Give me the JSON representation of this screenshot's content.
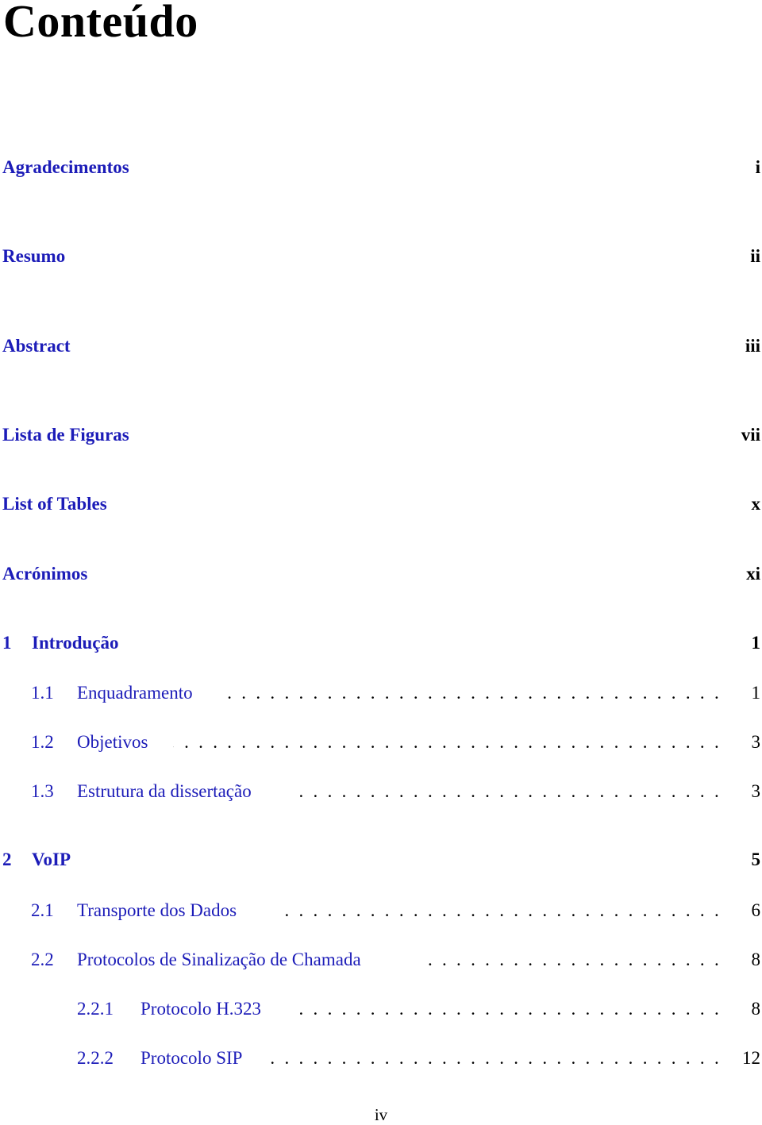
{
  "page_title": "Conteúdo",
  "colors": {
    "link": "#1c1cb8",
    "text": "#000000",
    "background": "#ffffff"
  },
  "front_matter": [
    {
      "title": "Agradecimentos",
      "page": "i"
    },
    {
      "title": "Resumo",
      "page": "ii"
    },
    {
      "title": "Abstract",
      "page": "iii"
    },
    {
      "title": "Lista de Figuras",
      "page": "vii"
    },
    {
      "title": "List of Tables",
      "page": "x"
    },
    {
      "title": "Acrónimos",
      "page": "xi"
    }
  ],
  "chapters": [
    {
      "number": "1",
      "title": "Introdução",
      "page": "1",
      "sections": [
        {
          "number": "1.1",
          "title": "Enquadramento",
          "page": "1"
        },
        {
          "number": "1.2",
          "title": "Objetivos",
          "page": "3"
        },
        {
          "number": "1.3",
          "title": "Estrutura da dissertação",
          "page": "3"
        }
      ]
    },
    {
      "number": "2",
      "title": "VoIP",
      "page": "5",
      "sections": [
        {
          "number": "2.1",
          "title": "Transporte dos Dados",
          "page": "6"
        },
        {
          "number": "2.2",
          "title": "Protocolos de Sinalização de Chamada",
          "page": "8"
        }
      ],
      "subsections": [
        {
          "number": "2.2.1",
          "title": "Protocolo H.323",
          "page": "8"
        },
        {
          "number": "2.2.2",
          "title": "Protocolo SIP",
          "page": "12"
        }
      ]
    }
  ],
  "footer": {
    "page_number": "iv"
  }
}
